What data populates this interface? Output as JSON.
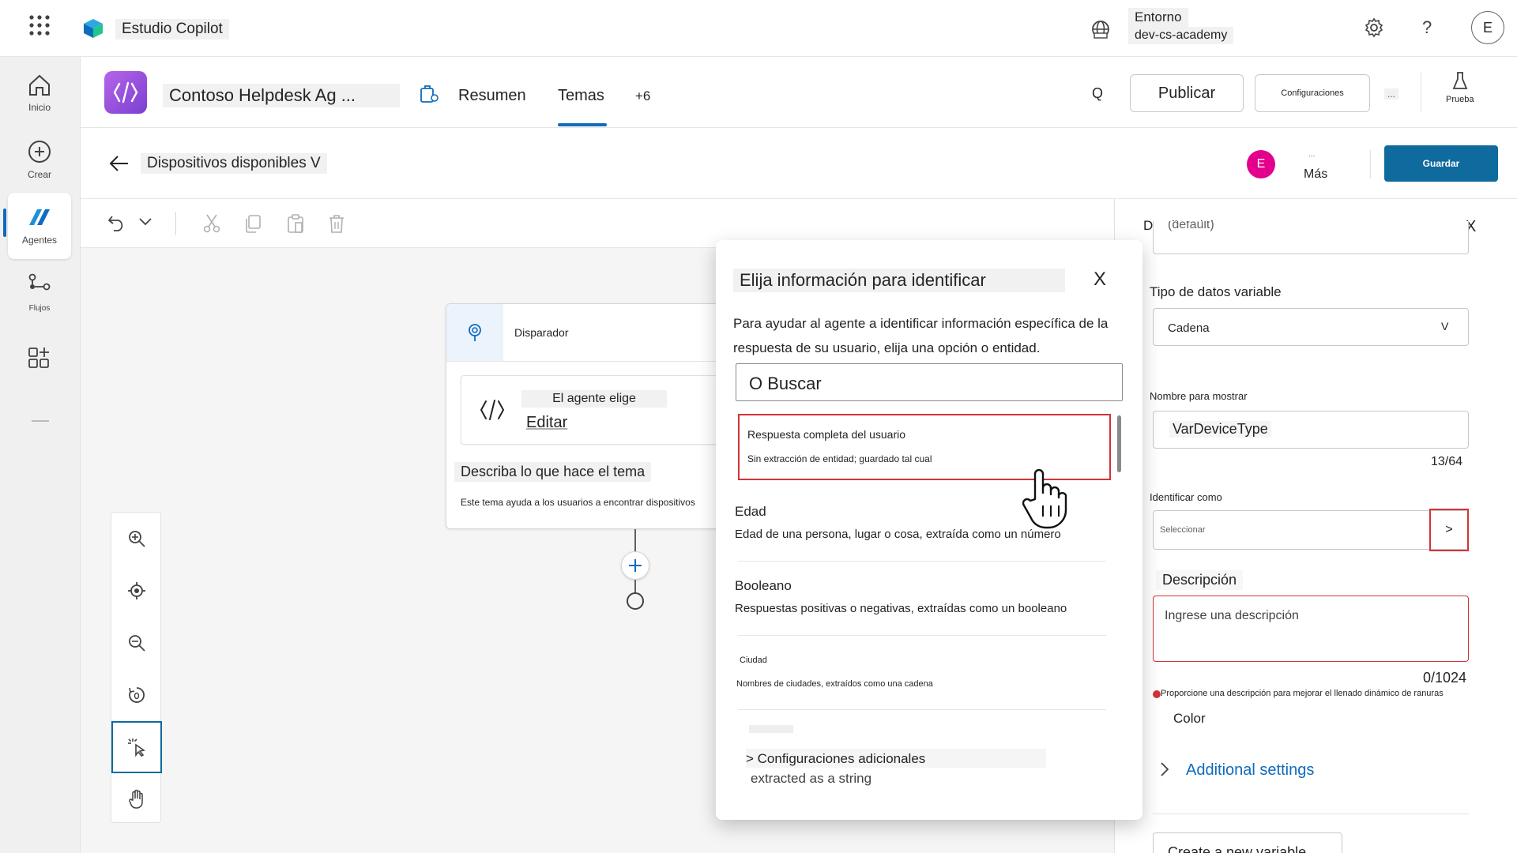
{
  "app": {
    "title": "Estudio Copilot",
    "environment_label": "Entorno",
    "environment_name": "dev-cs-academy",
    "help": "?",
    "avatar": "E"
  },
  "rail": {
    "home": "Inicio",
    "create": "Crear",
    "agents": "Agentes",
    "flows": "Flujos"
  },
  "agent": {
    "name": "Contoso Helpdesk Ag ...",
    "tabs": [
      "Resumen",
      "Temas",
      "+6"
    ],
    "active_tab": "Temas",
    "search_short": "Q",
    "publish": "Publicar",
    "settings": "Configuraciones",
    "more": "...",
    "test": "Prueba"
  },
  "topic": {
    "title": "Dispositivos disponibles V",
    "avatar": "E",
    "more_dots": "...",
    "more_label": "Más",
    "save": "Guardar"
  },
  "canvas": {
    "trigger_label": "Disparador",
    "agent_chooses": "El agente elige",
    "edit": "Editar",
    "describe": "Describa lo que hace el tema",
    "description": "Este tema ayuda a los usuarios a encontrar dispositivos"
  },
  "popup": {
    "title": "Elija información para identificar",
    "close": "X",
    "intro": "Para ayudar al agente a identificar información específica de la respuesta de su usuario, elija una opción o entidad.",
    "search_placeholder": "O Buscar",
    "options": [
      {
        "title": "Respuesta completa del usuario",
        "desc": "Sin extracción de entidad; guardado tal cual"
      },
      {
        "title": "Edad",
        "desc": "Edad de una persona, lugar o cosa, extraída como un número"
      },
      {
        "title": "Booleano",
        "desc": "Respuestas positivas o negativas, extraídas como un booleano"
      },
      {
        "title": "Ciudad",
        "desc": "Nombres de ciudades, extraídos como una cadena"
      }
    ],
    "extra_settings": "> Configuraciones adicionales",
    "extracted_string": "extracted as a string"
  },
  "panel": {
    "title": "Detalles del tema",
    "close": "X",
    "default_value": "(default)",
    "datatype_label": "Tipo de datos variable",
    "datatype_value": "Cadena",
    "datatype_chevron": "V",
    "display_name_label": "Nombre para mostrar",
    "display_name_value": "VarDeviceType",
    "display_name_count": "13/64",
    "identify_label": "Identificar como",
    "identify_placeholder": "Seleccionar",
    "identify_arrow": ">",
    "description_label": "Descripción",
    "description_placeholder": "Ingrese una descripción",
    "description_count": "0/1024",
    "description_hint": "Proporcione una descripción para mejorar el llenado dinámico de ranuras",
    "color_label": "Color",
    "additional_settings": "Additional settings",
    "create_variable": "Create a new variable"
  },
  "colors": {
    "accent": "#0f6cbd",
    "save_button": "#0f6a9e",
    "highlight_red": "#d13438",
    "agent_icon_gradient_start": "#b665e8",
    "agent_icon_gradient_end": "#7a3fd1",
    "avatar_pink": "#e3008c"
  }
}
